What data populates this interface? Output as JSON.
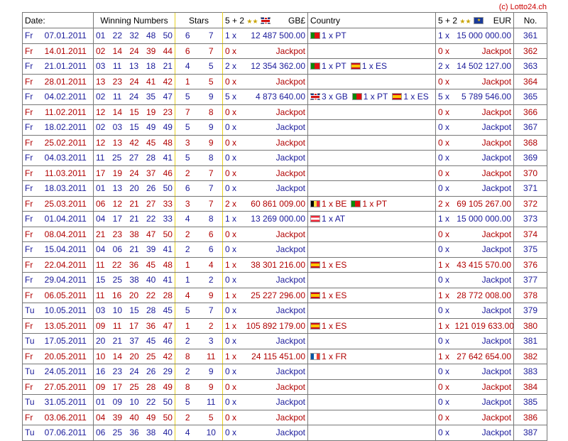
{
  "copyright": "(c) Lotto24.ch",
  "headers": {
    "date": "Date:",
    "winning": "Winning Numbers",
    "stars": "Stars",
    "gbp_label": "5 + 2",
    "gbp_currency": "GB£",
    "country": "Country",
    "eur_label": "5 + 2",
    "eur_currency": "EUR",
    "no": "No."
  },
  "rows": [
    {
      "day": "Fr",
      "date": "07.01.2011",
      "nums": [
        "01",
        "22",
        "32",
        "48",
        "50"
      ],
      "stars": [
        "6",
        "7"
      ],
      "gb_count": "1 x",
      "gb_amount": "12 487 500.00",
      "countries": [
        {
          "flag": "pt",
          "text": "1 x PT"
        }
      ],
      "eu_count": "1 x",
      "eu_amount": "15 000 000.00",
      "no": "361",
      "color": "blue"
    },
    {
      "day": "Fr",
      "date": "14.01.2011",
      "nums": [
        "02",
        "14",
        "24",
        "39",
        "44"
      ],
      "stars": [
        "6",
        "7"
      ],
      "gb_count": "0 x",
      "gb_amount": "Jackpot",
      "countries": [],
      "eu_count": "0 x",
      "eu_amount": "Jackpot",
      "no": "362",
      "color": "red"
    },
    {
      "day": "Fr",
      "date": "21.01.2011",
      "nums": [
        "03",
        "11",
        "13",
        "18",
        "21"
      ],
      "stars": [
        "4",
        "5"
      ],
      "gb_count": "2 x",
      "gb_amount": "12 354 362.00",
      "countries": [
        {
          "flag": "pt",
          "text": "1 x PT"
        },
        {
          "flag": "es",
          "text": "1 x ES"
        }
      ],
      "eu_count": "2 x",
      "eu_amount": "14 502 127.00",
      "no": "363",
      "color": "blue"
    },
    {
      "day": "Fr",
      "date": "28.01.2011",
      "nums": [
        "13",
        "23",
        "24",
        "41",
        "42"
      ],
      "stars": [
        "1",
        "5"
      ],
      "gb_count": "0 x",
      "gb_amount": "Jackpot",
      "countries": [],
      "eu_count": "0 x",
      "eu_amount": "Jackpot",
      "no": "364",
      "color": "red"
    },
    {
      "day": "Fr",
      "date": "04.02.2011",
      "nums": [
        "02",
        "11",
        "24",
        "35",
        "47"
      ],
      "stars": [
        "5",
        "9"
      ],
      "gb_count": "5 x",
      "gb_amount": "4 873 640.00",
      "countries": [
        {
          "flag": "gb",
          "text": "3 x GB"
        },
        {
          "flag": "pt",
          "text": "1 x PT"
        },
        {
          "flag": "es",
          "text": "1 x ES"
        }
      ],
      "eu_count": "5 x",
      "eu_amount": "5 789 546.00",
      "no": "365",
      "color": "blue"
    },
    {
      "day": "Fr",
      "date": "11.02.2011",
      "nums": [
        "12",
        "14",
        "15",
        "19",
        "23"
      ],
      "stars": [
        "7",
        "8"
      ],
      "gb_count": "0 x",
      "gb_amount": "Jackpot",
      "countries": [],
      "eu_count": "0 x",
      "eu_amount": "Jackpot",
      "no": "366",
      "color": "red"
    },
    {
      "day": "Fr",
      "date": "18.02.2011",
      "nums": [
        "02",
        "03",
        "15",
        "49",
        "49"
      ],
      "stars": [
        "5",
        "9"
      ],
      "gb_count": "0 x",
      "gb_amount": "Jackpot",
      "countries": [],
      "eu_count": "0 x",
      "eu_amount": "Jackpot",
      "no": "367",
      "color": "blue"
    },
    {
      "day": "Fr",
      "date": "25.02.2011",
      "nums": [
        "12",
        "13",
        "42",
        "45",
        "48"
      ],
      "stars": [
        "3",
        "9"
      ],
      "gb_count": "0 x",
      "gb_amount": "Jackpot",
      "countries": [],
      "eu_count": "0 x",
      "eu_amount": "Jackpot",
      "no": "368",
      "color": "red"
    },
    {
      "day": "Fr",
      "date": "04.03.2011",
      "nums": [
        "11",
        "25",
        "27",
        "28",
        "41"
      ],
      "stars": [
        "5",
        "8"
      ],
      "gb_count": "0 x",
      "gb_amount": "Jackpot",
      "countries": [],
      "eu_count": "0 x",
      "eu_amount": "Jackpot",
      "no": "369",
      "color": "blue"
    },
    {
      "day": "Fr",
      "date": "11.03.2011",
      "nums": [
        "17",
        "19",
        "24",
        "37",
        "46"
      ],
      "stars": [
        "2",
        "7"
      ],
      "gb_count": "0 x",
      "gb_amount": "Jackpot",
      "countries": [],
      "eu_count": "0 x",
      "eu_amount": "Jackpot",
      "no": "370",
      "color": "red"
    },
    {
      "day": "Fr",
      "date": "18.03.2011",
      "nums": [
        "01",
        "13",
        "20",
        "26",
        "50"
      ],
      "stars": [
        "6",
        "7"
      ],
      "gb_count": "0 x",
      "gb_amount": "Jackpot",
      "countries": [],
      "eu_count": "0 x",
      "eu_amount": "Jackpot",
      "no": "371",
      "color": "blue"
    },
    {
      "day": "Fr",
      "date": "25.03.2011",
      "nums": [
        "06",
        "12",
        "21",
        "27",
        "33"
      ],
      "stars": [
        "3",
        "7"
      ],
      "gb_count": "2 x",
      "gb_amount": "60 861 009.00",
      "countries": [
        {
          "flag": "be",
          "text": "1 x BE"
        },
        {
          "flag": "pt",
          "text": "1 x PT"
        }
      ],
      "eu_count": "2 x",
      "eu_amount": "69 105 267.00",
      "no": "372",
      "color": "red"
    },
    {
      "day": "Fr",
      "date": "01.04.2011",
      "nums": [
        "04",
        "17",
        "21",
        "22",
        "33"
      ],
      "stars": [
        "4",
        "8"
      ],
      "gb_count": "1 x",
      "gb_amount": "13 269 000.00",
      "countries": [
        {
          "flag": "at",
          "text": "1 x AT"
        }
      ],
      "eu_count": "1 x",
      "eu_amount": "15 000 000.00",
      "no": "373",
      "color": "blue"
    },
    {
      "day": "Fr",
      "date": "08.04.2011",
      "nums": [
        "21",
        "23",
        "38",
        "47",
        "50"
      ],
      "stars": [
        "2",
        "6"
      ],
      "gb_count": "0 x",
      "gb_amount": "Jackpot",
      "countries": [],
      "eu_count": "0 x",
      "eu_amount": "Jackpot",
      "no": "374",
      "color": "red"
    },
    {
      "day": "Fr",
      "date": "15.04.2011",
      "nums": [
        "04",
        "06",
        "21",
        "39",
        "41"
      ],
      "stars": [
        "2",
        "6"
      ],
      "gb_count": "0 x",
      "gb_amount": "Jackpot",
      "countries": [],
      "eu_count": "0 x",
      "eu_amount": "Jackpot",
      "no": "375",
      "color": "blue"
    },
    {
      "day": "Fr",
      "date": "22.04.2011",
      "nums": [
        "11",
        "22",
        "36",
        "45",
        "48"
      ],
      "stars": [
        "1",
        "4"
      ],
      "gb_count": "1 x",
      "gb_amount": "38 301 216.00",
      "countries": [
        {
          "flag": "es",
          "text": "1 x ES"
        }
      ],
      "eu_count": "1 x",
      "eu_amount": "43 415 570.00",
      "no": "376",
      "color": "red"
    },
    {
      "day": "Fr",
      "date": "29.04.2011",
      "nums": [
        "15",
        "25",
        "38",
        "40",
        "41"
      ],
      "stars": [
        "1",
        "2"
      ],
      "gb_count": "0 x",
      "gb_amount": "Jackpot",
      "countries": [],
      "eu_count": "0 x",
      "eu_amount": "Jackpot",
      "no": "377",
      "color": "blue"
    },
    {
      "day": "Fr",
      "date": "06.05.2011",
      "nums": [
        "11",
        "16",
        "20",
        "22",
        "28"
      ],
      "stars": [
        "4",
        "9"
      ],
      "gb_count": "1 x",
      "gb_amount": "25 227 296.00",
      "countries": [
        {
          "flag": "es",
          "text": "1 x ES"
        }
      ],
      "eu_count": "1 x",
      "eu_amount": "28 772 008.00",
      "no": "378",
      "color": "red"
    },
    {
      "day": "Tu",
      "date": "10.05.2011",
      "nums": [
        "03",
        "10",
        "15",
        "28",
        "45"
      ],
      "stars": [
        "5",
        "7"
      ],
      "gb_count": "0 x",
      "gb_amount": "Jackpot",
      "countries": [],
      "eu_count": "0 x",
      "eu_amount": "Jackpot",
      "no": "379",
      "color": "blue"
    },
    {
      "day": "Fr",
      "date": "13.05.2011",
      "nums": [
        "09",
        "11",
        "17",
        "36",
        "47"
      ],
      "stars": [
        "1",
        "2"
      ],
      "gb_count": "1 x",
      "gb_amount": "105 892 179.00",
      "countries": [
        {
          "flag": "es",
          "text": "1 x ES"
        }
      ],
      "eu_count": "1 x",
      "eu_amount": "121 019 633.00",
      "no": "380",
      "color": "red"
    },
    {
      "day": "Tu",
      "date": "17.05.2011",
      "nums": [
        "20",
        "21",
        "37",
        "45",
        "46"
      ],
      "stars": [
        "2",
        "3"
      ],
      "gb_count": "0 x",
      "gb_amount": "Jackpot",
      "countries": [],
      "eu_count": "0 x",
      "eu_amount": "Jackpot",
      "no": "381",
      "color": "blue"
    },
    {
      "day": "Fr",
      "date": "20.05.2011",
      "nums": [
        "10",
        "14",
        "20",
        "25",
        "42"
      ],
      "stars": [
        "8",
        "11"
      ],
      "gb_count": "1 x",
      "gb_amount": "24 115 451.00",
      "countries": [
        {
          "flag": "fr",
          "text": "1 x FR"
        }
      ],
      "eu_count": "1 x",
      "eu_amount": "27 642 654.00",
      "no": "382",
      "color": "red"
    },
    {
      "day": "Tu",
      "date": "24.05.2011",
      "nums": [
        "16",
        "23",
        "24",
        "26",
        "29"
      ],
      "stars": [
        "2",
        "9"
      ],
      "gb_count": "0 x",
      "gb_amount": "Jackpot",
      "countries": [],
      "eu_count": "0 x",
      "eu_amount": "Jackpot",
      "no": "383",
      "color": "blue"
    },
    {
      "day": "Fr",
      "date": "27.05.2011",
      "nums": [
        "09",
        "17",
        "25",
        "28",
        "49"
      ],
      "stars": [
        "8",
        "9"
      ],
      "gb_count": "0 x",
      "gb_amount": "Jackpot",
      "countries": [],
      "eu_count": "0 x",
      "eu_amount": "Jackpot",
      "no": "384",
      "color": "red"
    },
    {
      "day": "Tu",
      "date": "31.05.2011",
      "nums": [
        "01",
        "09",
        "10",
        "22",
        "50"
      ],
      "stars": [
        "5",
        "11"
      ],
      "gb_count": "0 x",
      "gb_amount": "Jackpot",
      "countries": [],
      "eu_count": "0 x",
      "eu_amount": "Jackpot",
      "no": "385",
      "color": "blue"
    },
    {
      "day": "Fr",
      "date": "03.06.2011",
      "nums": [
        "04",
        "39",
        "40",
        "49",
        "50"
      ],
      "stars": [
        "2",
        "5"
      ],
      "gb_count": "0 x",
      "gb_amount": "Jackpot",
      "countries": [],
      "eu_count": "0 x",
      "eu_amount": "Jackpot",
      "no": "386",
      "color": "red"
    },
    {
      "day": "Tu",
      "date": "07.06.2011",
      "nums": [
        "06",
        "25",
        "36",
        "38",
        "40"
      ],
      "stars": [
        "4",
        "10"
      ],
      "gb_count": "0 x",
      "gb_amount": "Jackpot",
      "countries": [],
      "eu_count": "0 x",
      "eu_amount": "Jackpot",
      "no": "387",
      "color": "blue"
    }
  ]
}
